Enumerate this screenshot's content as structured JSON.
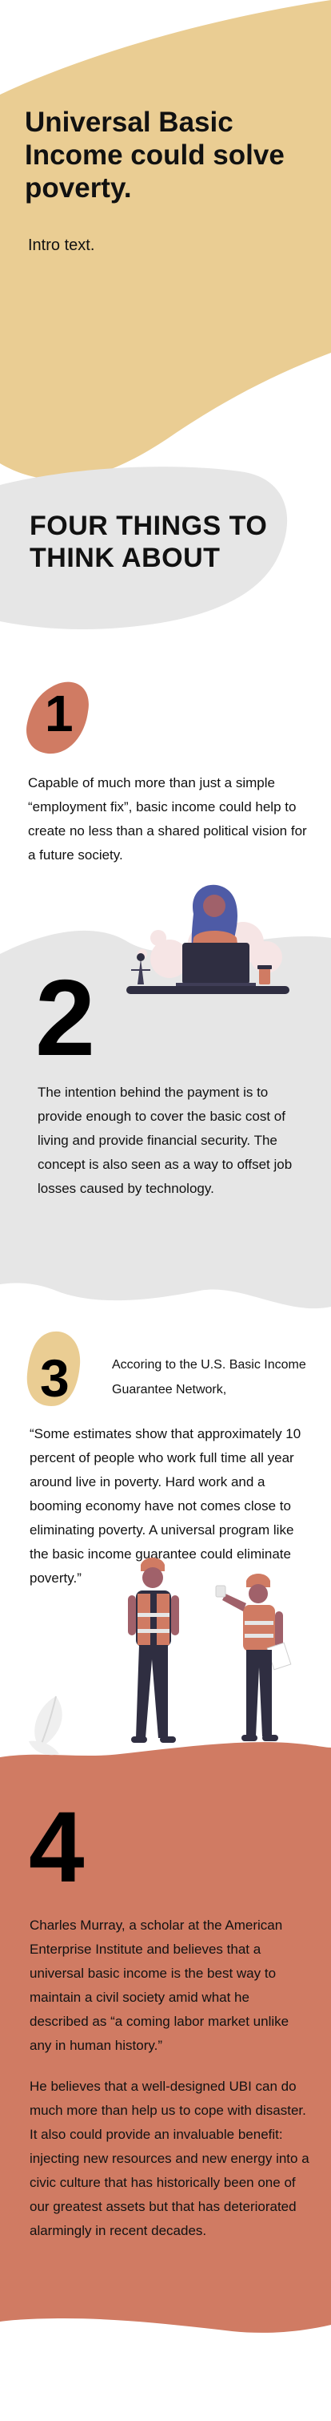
{
  "hero": {
    "title": "Universal Basic Income could solve poverty.",
    "intro": "Intro text."
  },
  "section_heading": "FOUR THINGS TO THINK ABOUT",
  "points": [
    {
      "number": "1",
      "paragraphs": [
        "Capable of much more than just a simple “employment fix”, basic income could help to create no less than a shared political vision for a future society."
      ]
    },
    {
      "number": "2",
      "paragraphs": [
        "The intention behind the payment is to provide enough to cover the basic cost of living and provide financial security. The concept is also seen as a way to offset job losses caused by technology."
      ]
    },
    {
      "number": "3",
      "lead": "Accoring to the U.S. Basic Income Guarantee Network,",
      "paragraphs": [
        "“Some estimates show that approximately 10 percent of people who work full time all year around live in poverty. Hard work and a booming economy have not comes close to eliminating poverty. A universal program like the basic income guarantee could eliminate poverty.”"
      ]
    },
    {
      "number": "4",
      "paragraphs": [
        "Charles Murray, a scholar at the American Enterprise Institute and believes that a universal basic income is the best way to maintain a civil society amid what he described as “a coming labor market unlike any in human history.”",
        "He believes that a well-designed UBI can do much more than help us to cope with disaster. It also could provide an invaluable benefit: injecting new resources and new energy into a civic culture that has historically been one of our greatest assets but that has deteriorated alarmingly in recent decades."
      ]
    }
  ],
  "colors": {
    "sand": "#EACD93",
    "terracotta": "#D07B63",
    "light_gray": "#E6E6E6",
    "navy": "#2F2E41",
    "text": "#111111"
  },
  "illustrations": [
    "person-at-laptop-illustration",
    "workers-illustration",
    "leaf-icon"
  ]
}
